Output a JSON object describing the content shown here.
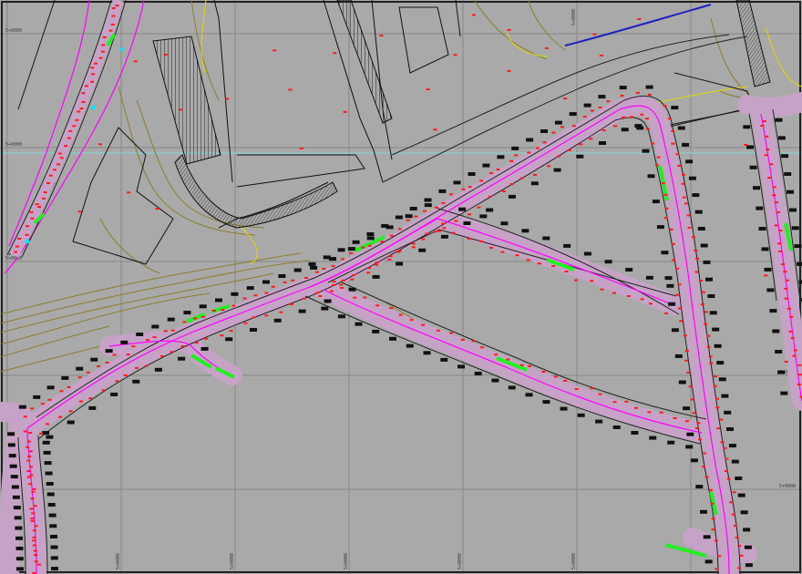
{
  "viewport": {
    "background": "#a9a9a9",
    "grid_color": "#888888",
    "crosshair_color": "#7fd7d7"
  },
  "drawing": {
    "road_fill": "#c6a3c6",
    "road_centerline": "#ff00ff",
    "road_edge": "#222222",
    "contour_color": "#8b7d2a",
    "contour_highlight": "#e6d400",
    "marker_color": "#ff1a1a",
    "median_color": "#22ee22",
    "building_color": "#111111",
    "utility_line": "#2020c0",
    "point_highlight": "#00e5ff"
  },
  "grid": {
    "x_labels": [
      "5+0000",
      "5+0000",
      "5+0000",
      "5+0000",
      "5+0000",
      "5+0000"
    ],
    "y_labels": [
      "5+0000",
      "5+0000",
      "5+0000",
      "5+0000",
      "5+0000"
    ]
  }
}
